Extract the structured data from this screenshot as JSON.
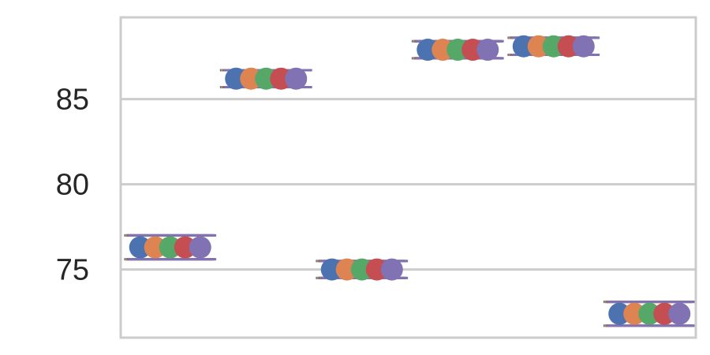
{
  "chart_data": {
    "type": "scatter",
    "title": "",
    "xlabel": "",
    "ylabel": "",
    "ylim": [
      71.0,
      89.8
    ],
    "yticks": [
      75,
      80,
      85
    ],
    "grid": true,
    "legend": "none",
    "x_groups": 6,
    "series": [
      {
        "color": "#4c72b0",
        "values": [
          76.3,
          86.2,
          75.0,
          87.9,
          88.1,
          72.4
        ],
        "errors": [
          0.7,
          0.5,
          0.5,
          0.5,
          0.5,
          0.7
        ]
      },
      {
        "color": "#dd8452",
        "values": [
          76.3,
          86.2,
          75.0,
          87.9,
          88.1,
          72.4
        ],
        "errors": [
          0.7,
          0.5,
          0.5,
          0.5,
          0.5,
          0.7
        ]
      },
      {
        "color": "#55a868",
        "values": [
          76.3,
          86.2,
          75.0,
          87.9,
          88.1,
          72.4
        ],
        "errors": [
          0.7,
          0.5,
          0.5,
          0.5,
          0.5,
          0.7
        ]
      },
      {
        "color": "#c44e52",
        "values": [
          76.3,
          86.2,
          75.0,
          87.9,
          88.1,
          72.4
        ],
        "errors": [
          0.7,
          0.5,
          0.5,
          0.5,
          0.5,
          0.7
        ]
      },
      {
        "color": "#8172b3",
        "values": [
          76.3,
          86.2,
          75.0,
          87.9,
          88.1,
          72.4
        ],
        "errors": [
          0.7,
          0.5,
          0.5,
          0.5,
          0.5,
          0.7
        ]
      }
    ]
  }
}
